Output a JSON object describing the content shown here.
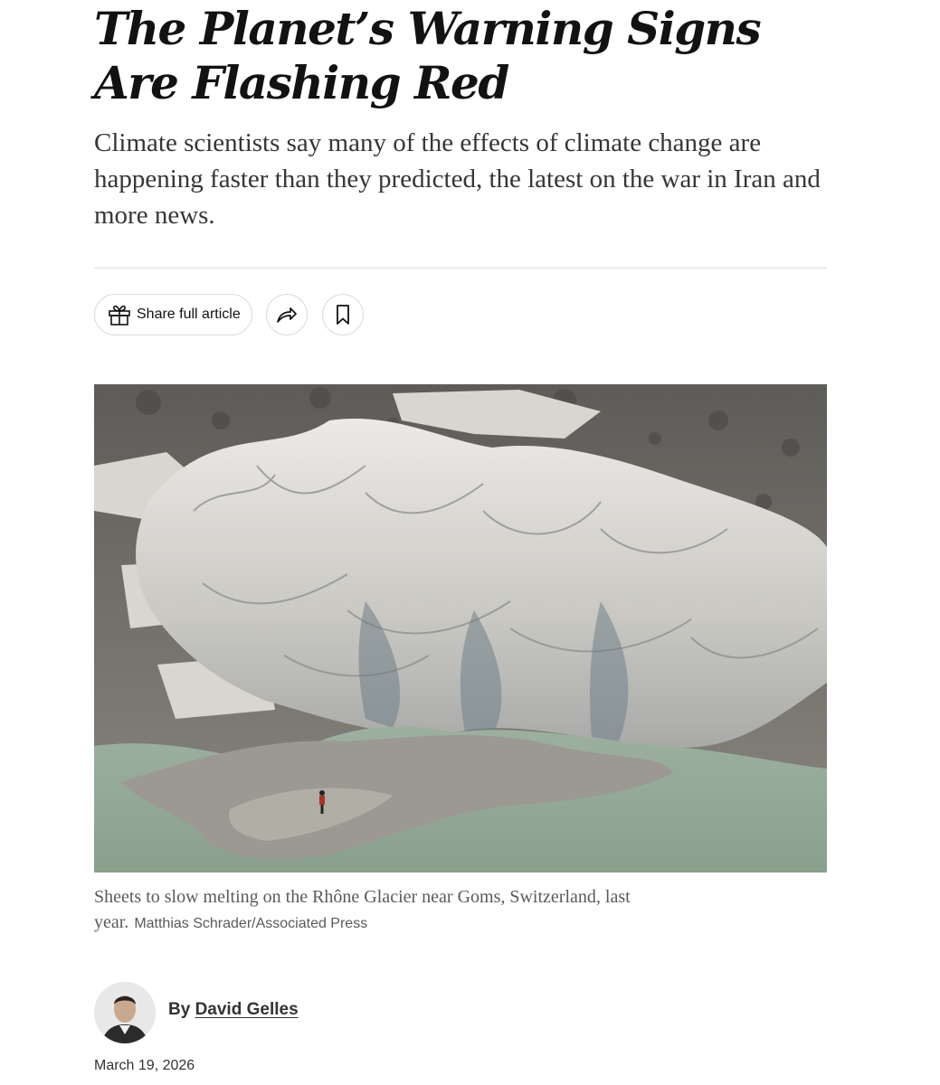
{
  "article": {
    "headline": "The Planet’s Warning Signs Are Flashing Red",
    "summary": "Climate scientists say many of the effects of climate change are happening faster than they predicted, the latest on the war in Iran and more news."
  },
  "toolbar": {
    "share_label": "Share full article",
    "icons": [
      "gift-icon",
      "share-arrow-icon",
      "bookmark-icon"
    ]
  },
  "photo": {
    "caption": "Sheets to slow melting on the Rhône Glacier near Goms, Switzerland, last year.",
    "credit": "Matthias Schrader/Associated Press"
  },
  "byline": {
    "prefix": "By",
    "author": "David Gelles",
    "date": "March 19, 2026"
  },
  "colors": {
    "text": "#121212",
    "summary": "#363636",
    "caption": "#5a5a5a",
    "border": "#dcdcdc",
    "lake": "#8fa795"
  }
}
